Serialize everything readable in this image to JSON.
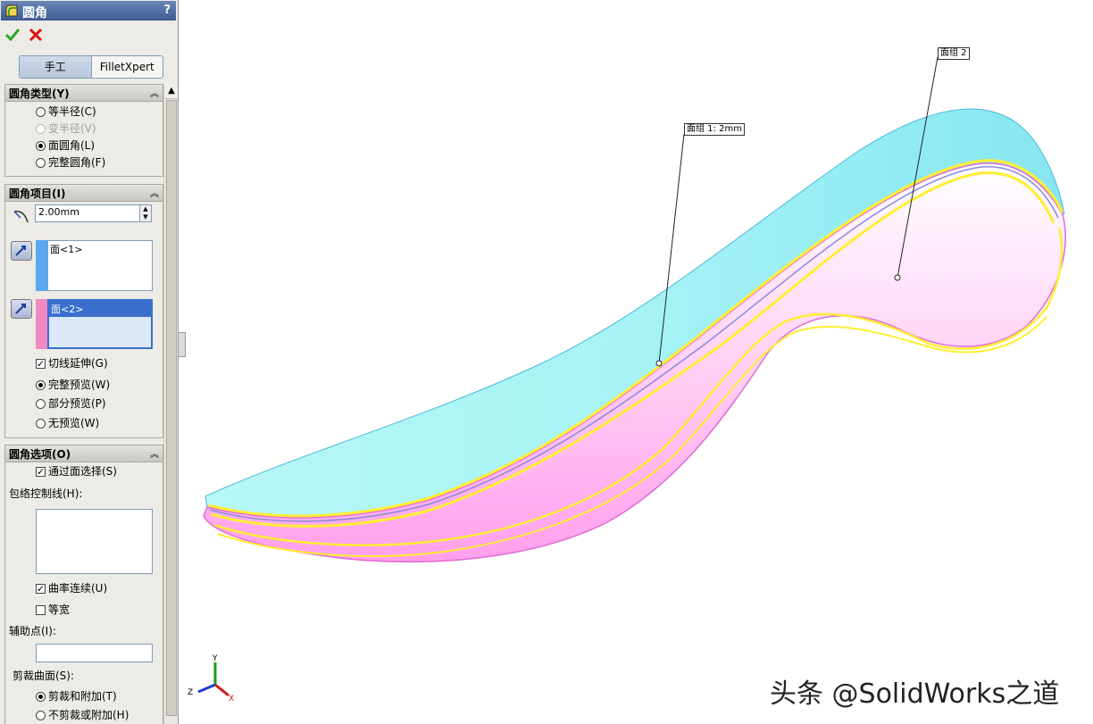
{
  "panel": {
    "title": "圆角",
    "help": "?",
    "tabs": [
      "手工",
      "FilletXpert"
    ],
    "fillet_type": {
      "header": "圆角类型(Y)",
      "options": [
        "等半径(C)",
        "变半径(V)",
        "面圆角(L)",
        "完整圆角(F)"
      ],
      "selected": "面圆角(L)",
      "disabled": "变半径(V)"
    },
    "fillet_items": {
      "header": "圆角项目(I)",
      "radius": "2.00mm",
      "face_set_1": [
        "面<1>"
      ],
      "face_set_2": [
        "面<2>"
      ],
      "tangent_propagation": "切线延伸(G)",
      "preview_options": [
        "完整预览(W)",
        "部分预览(P)",
        "无预览(W)"
      ],
      "preview_selected": "完整预览(W)"
    },
    "fillet_options": {
      "header": "圆角选项(O)",
      "select_through_faces": "通过面选择(S)",
      "hold_line_label": "包络控制线(H):",
      "curvature_continuous": "曲率连续(U)",
      "constant_width": "等宽",
      "help_point_label": "辅助点(I):",
      "trim_label": "剪裁曲面(S):",
      "trim_options": [
        "剪裁和附加(T)",
        "不剪裁或附加(H)"
      ],
      "trim_selected": "剪裁和附加(T)"
    }
  },
  "viewport": {
    "callout_1": "面组 1: 2mm",
    "callout_2": "面组 2",
    "triad": {
      "x": "X",
      "y": "Y",
      "z": "Z"
    },
    "watermark": "头条 @SolidWorks之道"
  },
  "colors": {
    "face_set_1": "#5aa9f0",
    "face_set_2": "#f08ac0",
    "surface_top": "#8ff0f5",
    "surface_bottom": "#ffa0ee",
    "edge_highlight": "#ffee33"
  }
}
